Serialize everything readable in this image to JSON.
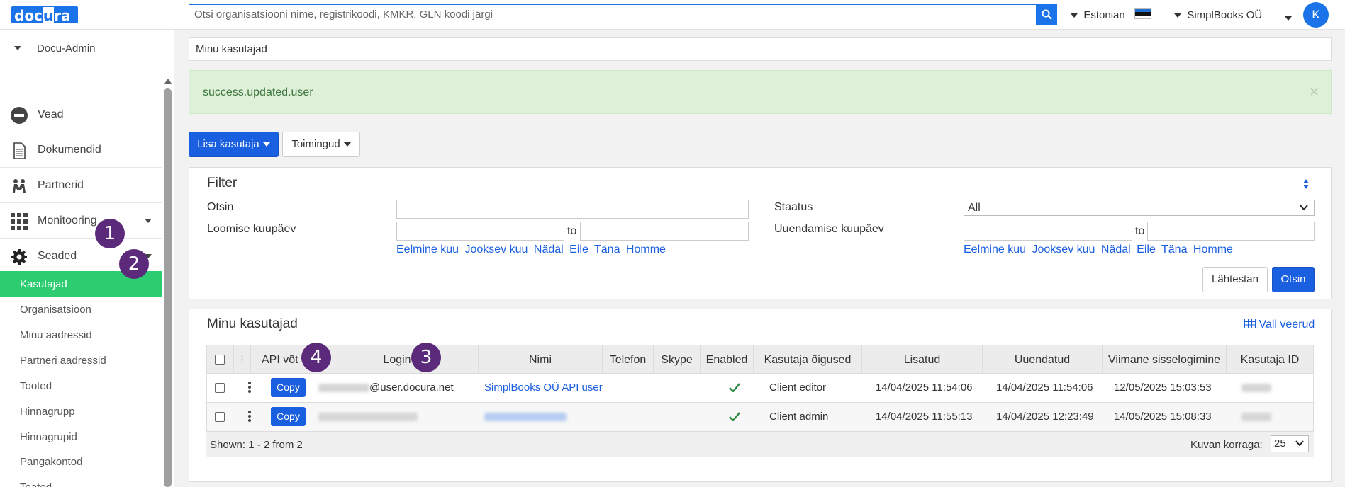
{
  "topbar": {
    "logo_part1": "doc",
    "logo_part2": "u",
    "logo_part3": "ra",
    "search_placeholder": "Otsi organisatsiooni nime, registrikoodi, KMKR, GLN koodi järgi",
    "language": "Estonian",
    "company": "SimplBooks OÜ",
    "avatar_initial": "K"
  },
  "sidebar": {
    "header": "Docu-Admin",
    "items": [
      {
        "label": "Vead",
        "icon": "no-entry-icon"
      },
      {
        "label": "Dokumendid",
        "icon": "document-icon"
      },
      {
        "label": "Partnerid",
        "icon": "partners-icon"
      },
      {
        "label": "Monitooring",
        "icon": "grid-icon"
      },
      {
        "label": "Seaded",
        "icon": "gear-icon"
      }
    ],
    "subitems": [
      {
        "label": "Kasutajad",
        "active": true
      },
      {
        "label": "Organisatsioon"
      },
      {
        "label": "Minu aadressid"
      },
      {
        "label": "Partneri aadressid"
      },
      {
        "label": "Tooted"
      },
      {
        "label": "Hinnagrupp"
      },
      {
        "label": "Hinnagrupid"
      },
      {
        "label": "Pangakontod"
      },
      {
        "label": "Teated"
      }
    ]
  },
  "annotations": [
    "1",
    "2",
    "3",
    "4"
  ],
  "breadcrumb": "Minu kasutajad",
  "alert": {
    "message": "success.updated.user",
    "close": "×"
  },
  "toolbar": {
    "add_user": "Lisa kasutaja",
    "actions": "Toimingud"
  },
  "filter": {
    "title": "Filter",
    "search_label": "Otsin",
    "created_label": "Loomise kuupäev",
    "status_label": "Staatus",
    "status_value": "All",
    "updated_label": "Uuendamise kuupäev",
    "to": "to",
    "quick_links": [
      "Eelmine kuu",
      "Jooksev kuu",
      "Nädal",
      "Eile",
      "Täna",
      "Homme"
    ],
    "reset_button": "Lähtestan",
    "search_button": "Otsin"
  },
  "users_table": {
    "title": "Minu kasutajad",
    "choose_columns": "Vali veerud",
    "columns": [
      "API võt",
      "Login",
      "Nimi",
      "Telefon",
      "Skype",
      "Enabled",
      "Kasutaja õigused",
      "Lisatud",
      "Uuendatud",
      "Viimane sisselogimine",
      "Kasutaja ID"
    ],
    "rows": [
      {
        "copy": "Copy",
        "login_suffix": "@user.docura.net",
        "name": "SimplBooks OÜ API user",
        "rights": "Client editor",
        "added": "14/04/2025 11:54:06",
        "updated": "14/04/2025 11:54:06",
        "last_login": "12/05/2025 15:03:53"
      },
      {
        "copy": "Copy",
        "login_suffix": "",
        "name": "",
        "rights": "Client admin",
        "added": "14/04/2025 11:55:13",
        "updated": "14/04/2025 12:23:49",
        "last_login": "14/05/2025 15:08:33"
      }
    ],
    "shown": "Shown: 1 - 2 from 2",
    "per_page_label": "Kuvan korraga:",
    "per_page_value": "25"
  },
  "colors": {
    "accent": "#1a5fe0",
    "active_menu": "#2ecc71",
    "badge": "#5b2a7a",
    "alert_bg": "#dff0d8"
  }
}
